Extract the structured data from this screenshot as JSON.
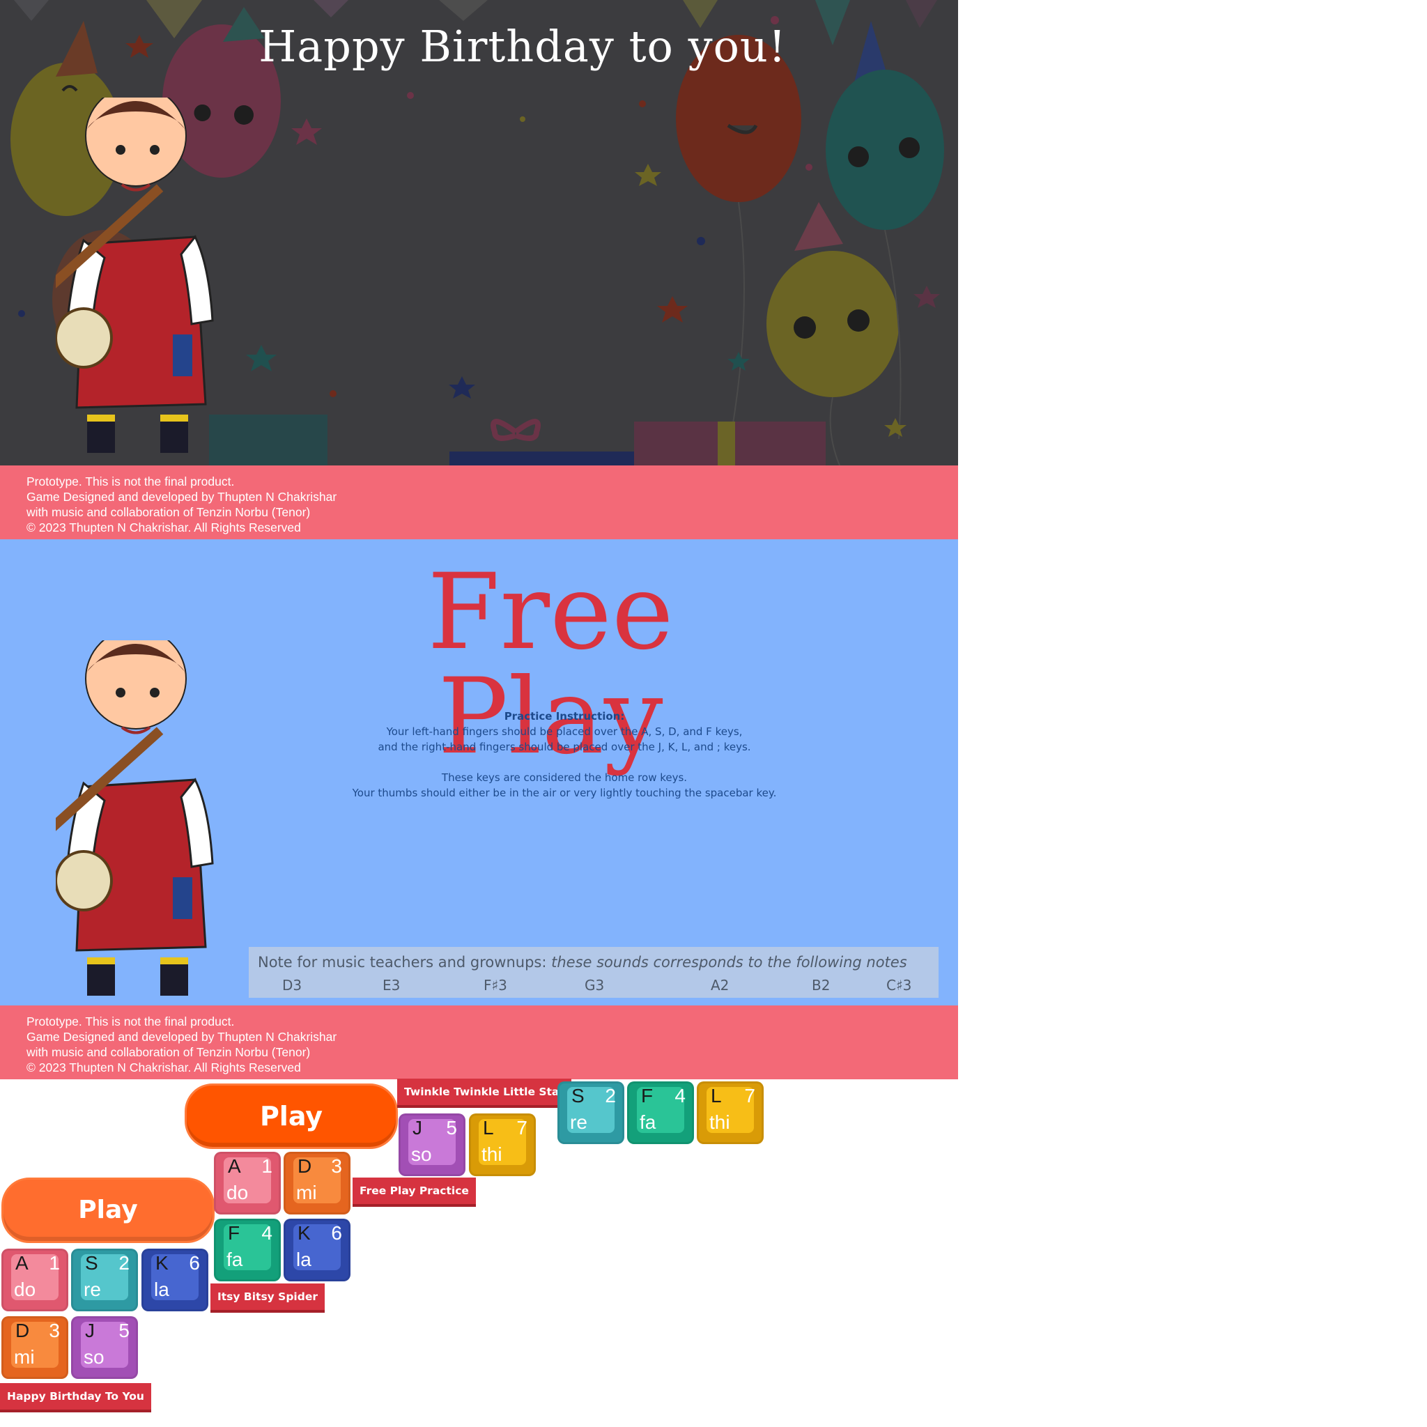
{
  "birthday_screen": {
    "title": "Happy Birthday to you!"
  },
  "footer": {
    "line1": "Prototype. This is not the final product.",
    "line2": "Game Designed and developed by Thupten N Chakrishar",
    "line3": "with music and collaboration of Tenzin Norbu (Tenor)",
    "line4": "© 2023 Thupten N Chakrishar. All Rights Reserved"
  },
  "free_play_screen": {
    "title": "Free Play",
    "instruction_heading": "Practice Instruction:",
    "instruction_line1": "Your left-hand fingers should be placed over the A, S, D, and F keys,",
    "instruction_line2": "and the right-hand fingers should be placed over the J, K, L, and ; keys.",
    "instruction_line3": "These keys are considered the home row keys.",
    "instruction_line4": "Your thumbs should either be in the air or very lightly touching the spacebar key.",
    "note_label": "Note for music teachers and grownups:",
    "note_text": "these sounds corresponds to the following notes",
    "notes": [
      "D3",
      "E3",
      "F♯3",
      "G3",
      "A2",
      "B2",
      "C♯3"
    ]
  },
  "sprites": {
    "play_label": "Play",
    "songs": {
      "twinkle": "Twinkle Twinkle Little Star",
      "free_play": "Free Play Practice",
      "itsy": "Itsy Bitsy Spider",
      "birthday": "Happy Birthday To You"
    },
    "keys": {
      "a": {
        "letter": "A",
        "num": "1",
        "sol": "do",
        "color": "#e0586f",
        "cap": "#f38a9c"
      },
      "s": {
        "letter": "S",
        "num": "2",
        "sol": "re",
        "color": "#2e9aa3",
        "cap": "#55c6cc"
      },
      "d": {
        "letter": "D",
        "num": "3",
        "sol": "mi",
        "color": "#e5651f",
        "cap": "#f88a3e"
      },
      "f": {
        "letter": "F",
        "num": "4",
        "sol": "fa",
        "color": "#13a07a",
        "cap": "#2ac497"
      },
      "j": {
        "letter": "J",
        "num": "5",
        "sol": "so",
        "color": "#a24fb5",
        "cap": "#c979d8"
      },
      "k": {
        "letter": "K",
        "num": "6",
        "sol": "la",
        "color": "#2d47a8",
        "cap": "#4766d0"
      },
      "l": {
        "letter": "L",
        "num": "7",
        "sol": "thi",
        "color": "#d99b07",
        "cap": "#f7be17"
      }
    }
  }
}
